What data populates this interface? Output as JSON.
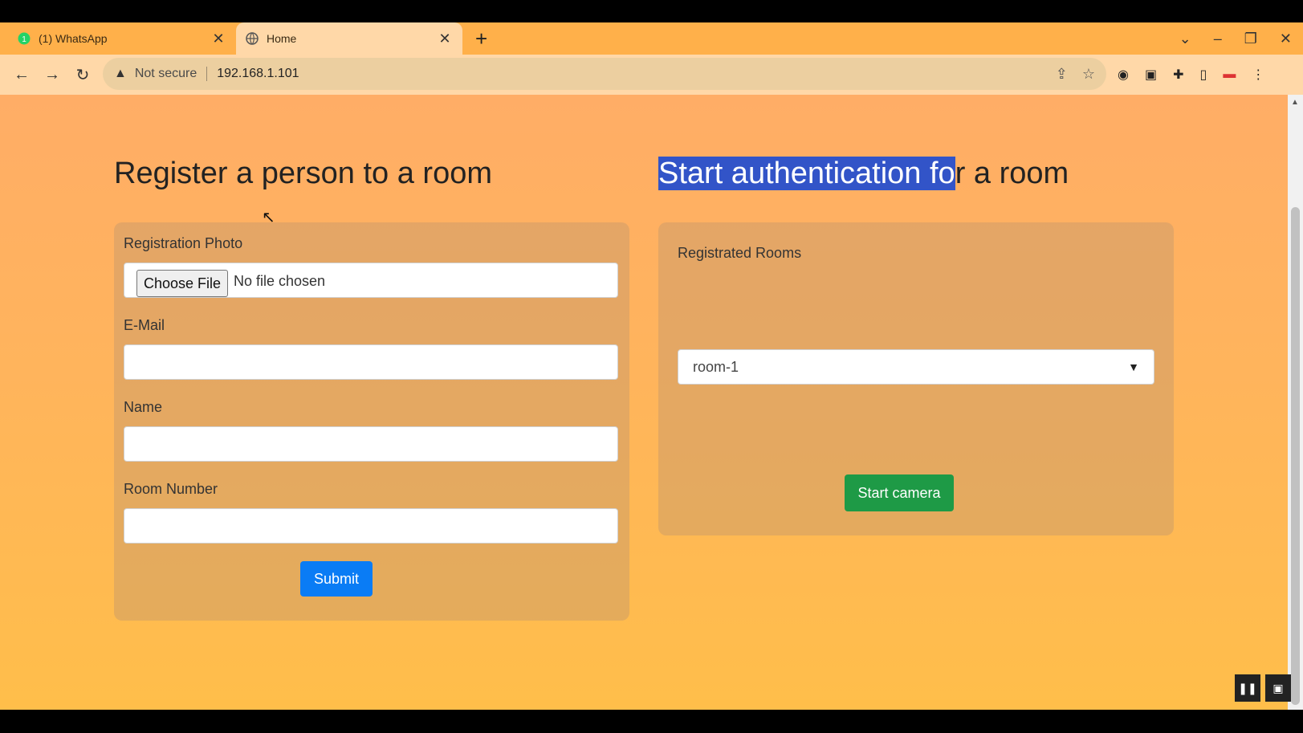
{
  "browser": {
    "tabs": [
      {
        "label": "(1) WhatsApp",
        "close": "✕",
        "icon": "whatsapp-icon",
        "active": false
      },
      {
        "label": "Home",
        "close": "✕",
        "icon": "globe-icon",
        "active": true
      }
    ],
    "new_tab": "+",
    "security_label": "Not secure",
    "url": "192.168.1.101"
  },
  "left": {
    "heading": "Register a person to a room",
    "photo_label": "Registration Photo",
    "choose_file": "Choose File",
    "no_file": "No file chosen",
    "email_label": "E-Mail",
    "name_label": "Name",
    "room_label": "Room Number",
    "submit": "Submit"
  },
  "right": {
    "heading_highlight": "Start authentication fo",
    "heading_rest": "r a room",
    "rooms_label": "Registrated Rooms",
    "selected_room": "room-1",
    "start_camera": "Start camera"
  },
  "colors": {
    "submit": "#0a7cf5",
    "start_camera": "#1e9a46",
    "highlight": "#3254c8"
  }
}
